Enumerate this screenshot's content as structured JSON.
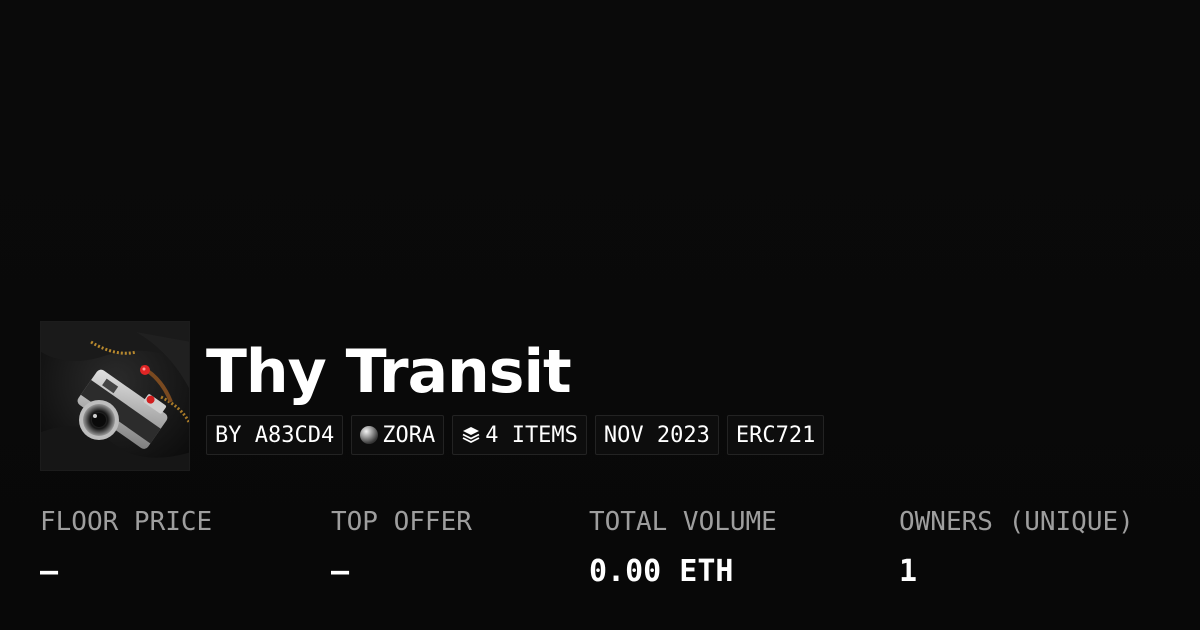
{
  "collection": {
    "title": "Thy Transit",
    "thumbnail_icon": "camera-photo-thumbnail"
  },
  "tags": {
    "creator": "BY A83CD4",
    "chain": "ZORA",
    "chain_icon": "chain-sphere-icon",
    "items": "4 ITEMS",
    "items_icon": "layers-stack-icon",
    "date": "NOV 2023",
    "standard": "ERC721"
  },
  "stats": {
    "floor_price": {
      "label": "FLOOR PRICE",
      "value": "–"
    },
    "top_offer": {
      "label": "TOP OFFER",
      "value": "–"
    },
    "total_volume": {
      "label": "TOTAL VOLUME",
      "value": "0.00 ETH"
    },
    "owners": {
      "label": "OWNERS (UNIQUE)",
      "value": "1"
    }
  },
  "colors": {
    "background": "#0a0a0a",
    "text": "#ffffff",
    "muted": "#9e9e9e",
    "pill_border": "#232323"
  }
}
